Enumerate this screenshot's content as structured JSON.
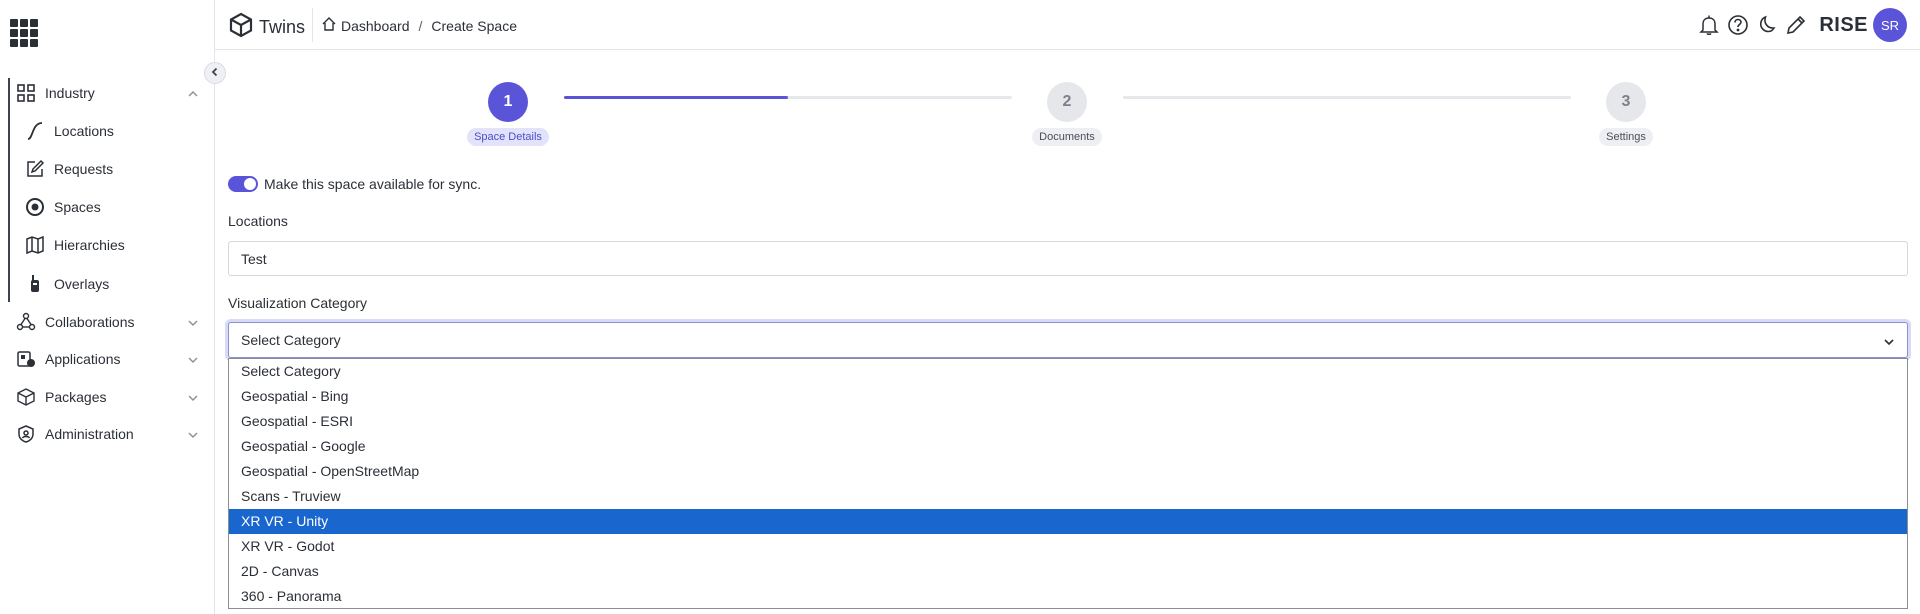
{
  "header": {
    "brand": "Twins",
    "breadcrumb": {
      "home": "Dashboard",
      "separator": "/",
      "current": "Create Space"
    },
    "org": "RISE",
    "avatar_initials": "SR"
  },
  "sidebar": {
    "items": [
      {
        "label": "Industry",
        "icon": "grid-icon",
        "expanded": true
      },
      {
        "label": "Locations",
        "icon": "path-icon"
      },
      {
        "label": "Requests",
        "icon": "edit-icon"
      },
      {
        "label": "Spaces",
        "icon": "target-icon"
      },
      {
        "label": "Hierarchies",
        "icon": "map-icon"
      },
      {
        "label": "Overlays",
        "icon": "walkie-icon"
      },
      {
        "label": "Collaborations",
        "icon": "network-icon"
      },
      {
        "label": "Applications",
        "icon": "apps-icon"
      },
      {
        "label": "Packages",
        "icon": "package-icon"
      },
      {
        "label": "Administration",
        "icon": "shield-icon"
      }
    ]
  },
  "stepper": {
    "steps": [
      {
        "number": "1",
        "label": "Space Details",
        "active": true
      },
      {
        "number": "2",
        "label": "Documents",
        "active": false
      },
      {
        "number": "3",
        "label": "Settings",
        "active": false
      }
    ],
    "progress_fraction": 0.5
  },
  "form": {
    "sync_toggle_label": "Make this space available for sync.",
    "sync_enabled": true,
    "locations_label": "Locations",
    "locations_value": "Test",
    "category_label": "Visualization Category",
    "category_selected": "Select Category",
    "category_options": [
      "Select Category",
      "Geospatial - Bing",
      "Geospatial - ESRI",
      "Geospatial - Google",
      "Geospatial - OpenStreetMap",
      "Scans - Truview",
      "XR VR - Unity",
      "XR VR - Godot",
      "2D - Canvas",
      "360 - Panorama"
    ],
    "highlighted_option": "XR VR - Unity"
  },
  "colors": {
    "accent": "#5a55d8",
    "highlight": "#1a66cf"
  }
}
